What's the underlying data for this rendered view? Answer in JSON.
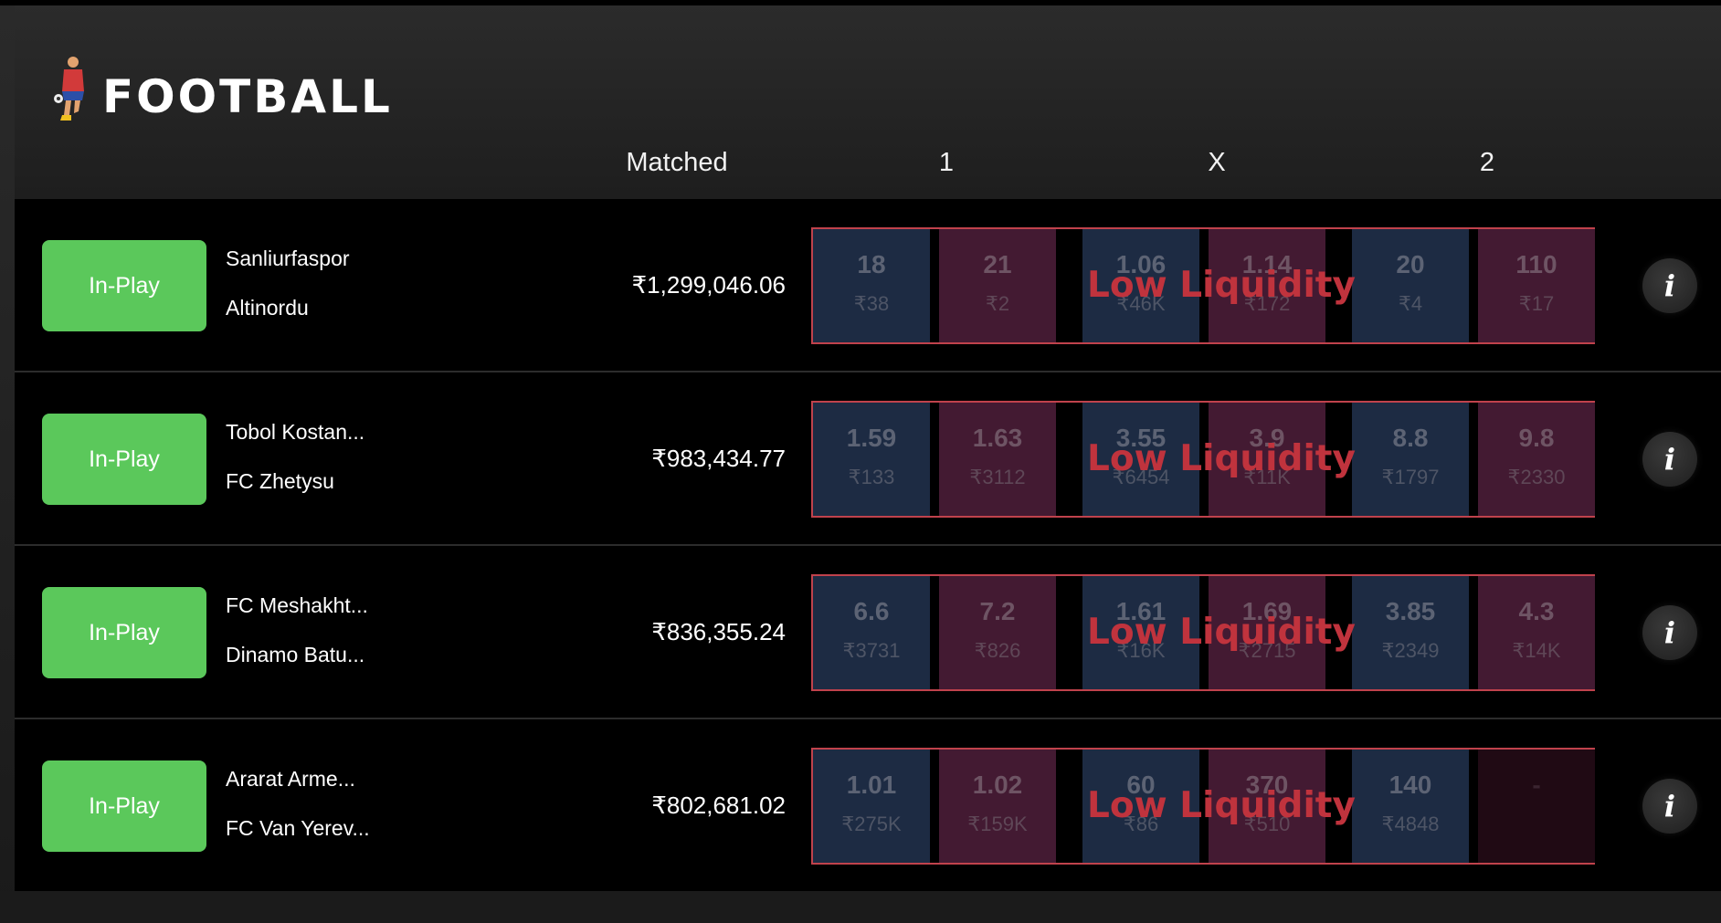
{
  "header": {
    "title": "FOOTBALL",
    "logo_icon": "football-player-icon",
    "columns": {
      "matched": "Matched",
      "one": "1",
      "x": "X",
      "two": "2"
    }
  },
  "colors": {
    "in_play": "#5bc85b",
    "back": "#1d2b43",
    "lay": "#431a32",
    "low_liquidity": "#c0333d"
  },
  "low_liquidity_label": "Low Liquidity",
  "matches": [
    {
      "status": "In-Play",
      "team_a": "Sanliurfaspor",
      "team_b": "Altinordu",
      "matched": "₹1,299,046.06",
      "odds": [
        {
          "price": "18",
          "size": "₹38"
        },
        {
          "price": "21",
          "size": "₹2"
        },
        {
          "price": "1.06",
          "size": "₹46K"
        },
        {
          "price": "1.14",
          "size": "₹172"
        },
        {
          "price": "20",
          "size": "₹4"
        },
        {
          "price": "110",
          "size": "₹17"
        }
      ]
    },
    {
      "status": "In-Play",
      "team_a": "Tobol Kostan...",
      "team_b": "FC Zhetysu",
      "matched": "₹983,434.77",
      "odds": [
        {
          "price": "1.59",
          "size": "₹133"
        },
        {
          "price": "1.63",
          "size": "₹3112"
        },
        {
          "price": "3.55",
          "size": "₹6454"
        },
        {
          "price": "3.9",
          "size": "₹11K"
        },
        {
          "price": "8.8",
          "size": "₹1797"
        },
        {
          "price": "9.8",
          "size": "₹2330"
        }
      ]
    },
    {
      "status": "In-Play",
      "team_a": "FC Meshakht...",
      "team_b": "Dinamo Batu...",
      "matched": "₹836,355.24",
      "odds": [
        {
          "price": "6.6",
          "size": "₹3731"
        },
        {
          "price": "7.2",
          "size": "₹826"
        },
        {
          "price": "1.61",
          "size": "₹16K"
        },
        {
          "price": "1.69",
          "size": "₹2715"
        },
        {
          "price": "3.85",
          "size": "₹2349"
        },
        {
          "price": "4.3",
          "size": "₹14K"
        }
      ]
    },
    {
      "status": "In-Play",
      "team_a": "Ararat Arme...",
      "team_b": "FC Van Yerev...",
      "matched": "₹802,681.02",
      "odds": [
        {
          "price": "1.01",
          "size": "₹275K"
        },
        {
          "price": "1.02",
          "size": "₹159K"
        },
        {
          "price": "60",
          "size": "₹86"
        },
        {
          "price": "370",
          "size": "₹510"
        },
        {
          "price": "140",
          "size": "₹4848"
        },
        {
          "price": "-",
          "size": ""
        }
      ]
    }
  ],
  "info_label": "i"
}
